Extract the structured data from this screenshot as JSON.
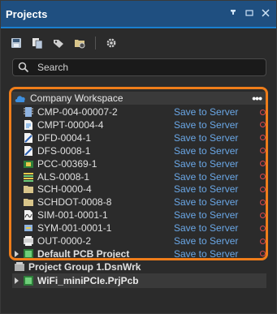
{
  "panel": {
    "title": "Projects"
  },
  "titlebar": {
    "pin_icon": "pin-icon",
    "float_icon": "float-icon",
    "close_icon": "close-icon"
  },
  "toolbar": {
    "buttons": [
      "save-icon",
      "copy-icon",
      "tag-icon",
      "folder-icon",
      "gear-icon"
    ]
  },
  "search": {
    "placeholder": "Search",
    "value": ""
  },
  "workspace": {
    "label": "Company Workspace",
    "more": "•••"
  },
  "items": [
    {
      "name": "CMP-004-00007-2",
      "status": "Save to Server",
      "icon": "component-icon"
    },
    {
      "name": "CMPT-00004-4",
      "status": "Save to Server",
      "icon": "document-icon"
    },
    {
      "name": "DFD-0004-1",
      "status": "Save to Server",
      "icon": "draftsman-icon"
    },
    {
      "name": "DFS-0008-1",
      "status": "Save to Server",
      "icon": "draftsman-icon"
    },
    {
      "name": "PCC-00369-1",
      "status": "Save to Server",
      "icon": "pcb-component-icon"
    },
    {
      "name": "ALS-0008-1",
      "status": "Save to Server",
      "icon": "layer-stack-icon"
    },
    {
      "name": "SCH-0000-4",
      "status": "Save to Server",
      "icon": "folder-icon"
    },
    {
      "name": "SCHDOT-0008-8",
      "status": "Save to Server",
      "icon": "folder-icon"
    },
    {
      "name": "SIM-001-0001-1",
      "status": "Save to Server",
      "icon": "simulation-icon"
    },
    {
      "name": "SYM-001-0001-1",
      "status": "Save to Server",
      "icon": "symbol-icon"
    },
    {
      "name": "OUT-0000-2",
      "status": "Save to Server",
      "icon": "output-icon"
    },
    {
      "name": "Default PCB Project",
      "status": "Save to Server",
      "icon": "pcb-project-icon"
    }
  ],
  "group": {
    "label": "Project Group 1.DsnWrk"
  },
  "pcb_project": {
    "label": "WiFi_miniPCIe.PrjPcb"
  },
  "colors": {
    "accent": "#ef7d1a",
    "link": "#6aa7e6",
    "status_dot": "#e04848",
    "title_bg": "#1f4f80"
  }
}
